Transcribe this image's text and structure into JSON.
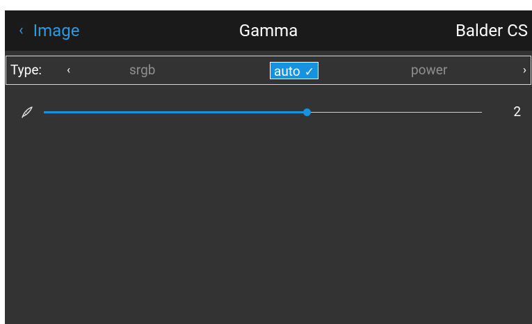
{
  "header": {
    "back_label": "Image",
    "back_icon": "chevron-left-icon",
    "title": "Gamma",
    "device": "Balder CS"
  },
  "type_selector": {
    "label": "Type:",
    "prev_icon": "chevron-left-icon",
    "next_icon": "chevron-right-icon",
    "options": [
      "srgb",
      "auto",
      "power"
    ],
    "selected": "auto",
    "selected_icon": "check-icon"
  },
  "gamma_slider": {
    "icon": "feather-icon",
    "value": "2",
    "fill_fraction": 0.6
  },
  "colors": {
    "accent": "#1592e0",
    "header_bg": "#1a1a1a",
    "panel_bg": "#333333",
    "text": "#ffffff",
    "muted_text": "#8f8f8f"
  }
}
